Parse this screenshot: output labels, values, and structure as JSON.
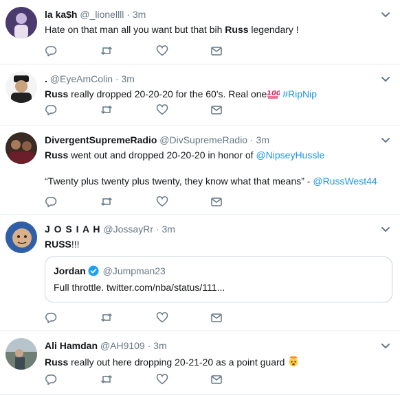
{
  "tweets": [
    {
      "name": "la ka$h",
      "handle": "@_lionellll",
      "separator": "·",
      "time": "3m",
      "text_before": "Hate on that man all you want but that bih ",
      "bold": "Russ",
      "text_after": " legendary !"
    },
    {
      "name": ".",
      "handle": "@EyeAmColin",
      "separator": "·",
      "time": "3m",
      "bold": "Russ",
      "text_after": " really dropped 20-20-20 for the 60's. Real one",
      "emoji": "hundred-points-emoji",
      "hashtag": "#RipNip"
    },
    {
      "name": "DivergentSupremeRadio",
      "handle": "@DivSupremeRadio",
      "separator": "·",
      "time": "3m",
      "bold": "Russ",
      "text_after": " went out and dropped 20-20-20 in honor of ",
      "mention": "@NipseyHussle",
      "line2_text": "“Twenty plus twenty plus twenty, they know what that means” - ",
      "line2_mention": "@RussWest44"
    },
    {
      "name": "J O S I A H",
      "handle": "@JossayRr",
      "separator": "·",
      "time": "3m",
      "bold": "RUSS",
      "text_after": "!!!",
      "quote": {
        "name": "Jordan",
        "handle": "@Jumpman23",
        "text": "Full throttle. twitter.com/nba/status/111..."
      }
    },
    {
      "name": "Ali Hamdan",
      "handle": "@AH9109",
      "separator": "·",
      "time": "3m",
      "bold": "Russ",
      "text_after": " really out here dropping 20-21-20 as a point guard ",
      "emoji": "exploding-head-emoji"
    }
  ],
  "colors": {
    "link": "#1b95e0",
    "muted": "#657786",
    "border": "#e6ecf0"
  },
  "icons": [
    "reply-icon",
    "retweet-icon",
    "like-icon",
    "direct-message-icon",
    "chevron-down-icon"
  ]
}
